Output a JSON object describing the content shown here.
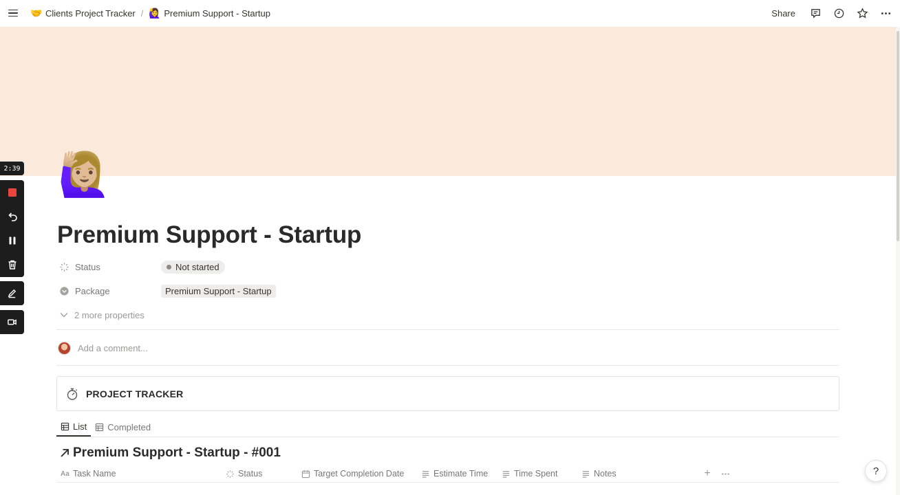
{
  "breadcrumb": {
    "items": [
      {
        "emoji": "🤝",
        "label": "Clients Project Tracker"
      },
      {
        "emoji": "🙋‍♀️",
        "label": "Premium Support - Startup"
      }
    ],
    "separator": "/"
  },
  "topbar": {
    "share_label": "Share",
    "icons": [
      "comment-icon",
      "clock-icon",
      "star-icon",
      "more-icon"
    ]
  },
  "recorder": {
    "timer": "2:39"
  },
  "page": {
    "icon_emoji": "🙋🏼‍♀️",
    "title": "Premium Support - Startup",
    "cover_color": "#fbeadc"
  },
  "properties": {
    "status": {
      "label": "Status",
      "value": "Not started"
    },
    "package": {
      "label": "Package",
      "value": "Premium Support - Startup"
    },
    "more": "2 more properties"
  },
  "comment": {
    "placeholder": "Add a comment..."
  },
  "callout": {
    "text": "PROJECT TRACKER"
  },
  "tabs": [
    {
      "label": "List",
      "active": true
    },
    {
      "label": "Completed",
      "active": false
    }
  ],
  "database": {
    "title": "Premium Support - Startup - #001",
    "columns": [
      {
        "label": "Task Name",
        "icon": "aa-icon"
      },
      {
        "label": "Status",
        "icon": "status-icon"
      },
      {
        "label": "Target Completion Date",
        "icon": "calendar-icon"
      },
      {
        "label": "Estimate Time",
        "icon": "text-icon"
      },
      {
        "label": "Time Spent",
        "icon": "text-icon"
      },
      {
        "label": "Notes",
        "icon": "text-icon"
      }
    ],
    "add_column": "+"
  },
  "help": {
    "label": "?"
  }
}
